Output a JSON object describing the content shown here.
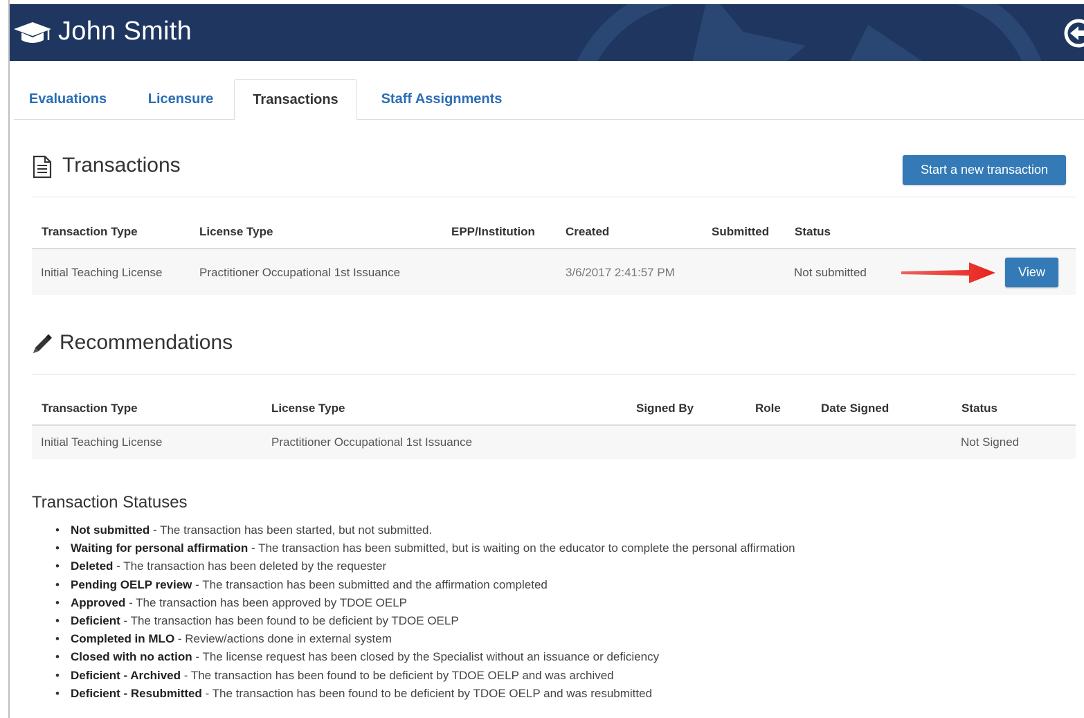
{
  "header": {
    "user_name": "John Smith",
    "bg_color": "#1e3660"
  },
  "tabs": [
    {
      "label": "Evaluations",
      "active": false
    },
    {
      "label": "Licensure",
      "active": false
    },
    {
      "label": "Transactions",
      "active": true
    },
    {
      "label": "Staff Assignments",
      "active": false
    }
  ],
  "transactions": {
    "title": "Transactions",
    "new_button": "Start a new transaction",
    "columns": [
      "Transaction Type",
      "License Type",
      "EPP/Institution",
      "Created",
      "Submitted",
      "Status"
    ],
    "rows": [
      {
        "transaction_type": "Initial Teaching License",
        "license_type": "Practitioner Occupational 1st Issuance",
        "epp_institution": "",
        "created": "3/6/2017 2:41:57 PM",
        "submitted": "",
        "status": "Not submitted",
        "action": "View"
      }
    ]
  },
  "recommendations": {
    "title": "Recommendations",
    "columns": [
      "Transaction Type",
      "License Type",
      "Signed By",
      "Role",
      "Date Signed",
      "Status"
    ],
    "rows": [
      {
        "transaction_type": "Initial Teaching License",
        "license_type": "Practitioner Occupational 1st Issuance",
        "signed_by": "",
        "role": "",
        "date_signed": "",
        "status": "Not Signed"
      }
    ]
  },
  "statuses": {
    "title": "Transaction Statuses",
    "items": [
      {
        "name": "Not submitted",
        "desc": " - The transaction has been started, but not submitted."
      },
      {
        "name": "Waiting for personal affirmation",
        "desc": " - The transaction has been submitted, but is waiting on the educator to complete the personal affirmation"
      },
      {
        "name": "Deleted",
        "desc": " - The transaction has been deleted by the requester"
      },
      {
        "name": "Pending OELP review",
        "desc": " - The transaction has been submitted and the affirmation completed"
      },
      {
        "name": "Approved",
        "desc": " - The transaction has been approved by TDOE OELP"
      },
      {
        "name": "Deficient",
        "desc": " - The transaction has been found to be deficient by TDOE OELP"
      },
      {
        "name": "Completed in MLO",
        "desc": " - Review/actions done in external system"
      },
      {
        "name": "Closed with no action",
        "desc": " - The license request has been closed by the Specialist without an issuance or deficiency"
      },
      {
        "name": "Deficient - Archived",
        "desc": " - The transaction has been found to be deficient by TDOE OELP and was archived"
      },
      {
        "name": "Deficient - Resubmitted",
        "desc": " - The transaction has been found to be deficient by TDOE OELP and was resubmitted"
      }
    ]
  },
  "colors": {
    "link": "#2a6db5",
    "primary_button": "#337ab7",
    "annotation_arrow": "#e8231b"
  }
}
